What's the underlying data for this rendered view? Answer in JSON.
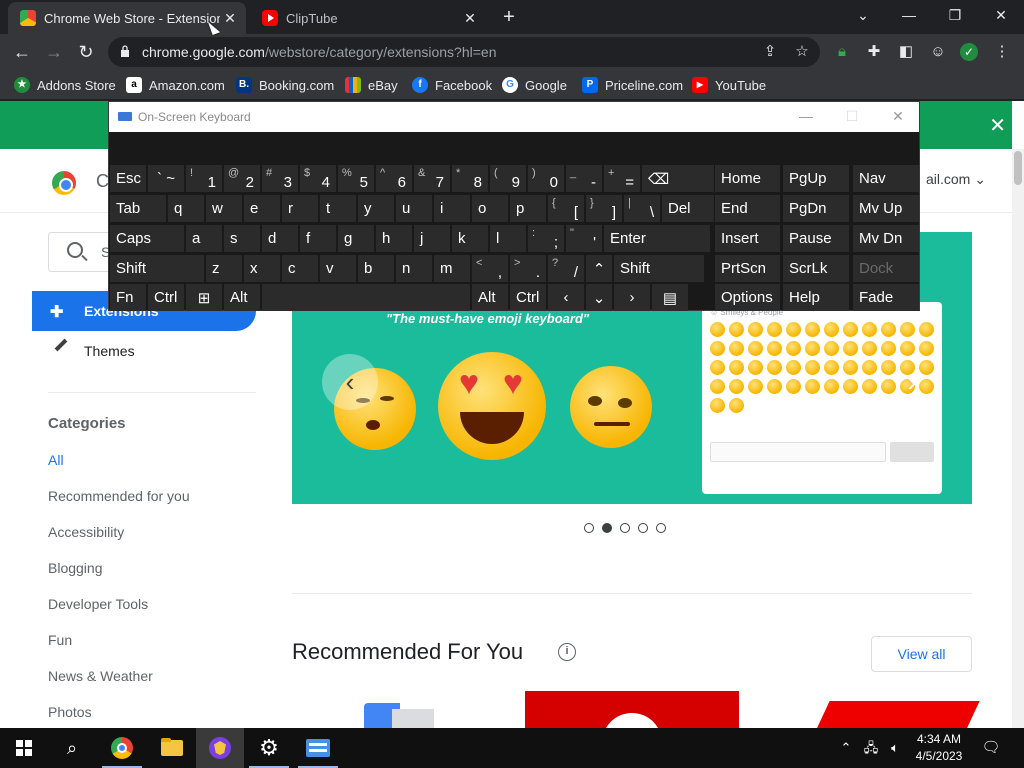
{
  "browser": {
    "tabs": [
      {
        "title": "Chrome Web Store - Extensions",
        "active": true
      },
      {
        "title": "ClipTube",
        "active": false
      }
    ],
    "window_controls": {
      "tab_search": "⌄",
      "minimize": "—",
      "restore": "❐",
      "close": "✕"
    },
    "url": {
      "host": "chrome.google.com",
      "path": "/webstore/category/extensions?hl=en"
    },
    "bookmarks": [
      {
        "label": "Addons Store",
        "icon": "addons-store-icon",
        "color": "#1e8e3e",
        "glyph": "★"
      },
      {
        "label": "Amazon.com",
        "icon": "amazon-icon",
        "color": "#ffffff",
        "glyph": "a"
      },
      {
        "label": "Booking.com",
        "icon": "booking-icon",
        "color": "#003580",
        "glyph": "B."
      },
      {
        "label": "eBay",
        "icon": "ebay-icon",
        "color": "#e53238",
        "glyph": "e"
      },
      {
        "label": "Facebook",
        "icon": "facebook-icon",
        "color": "#1877f2",
        "glyph": "f"
      },
      {
        "label": "Google",
        "icon": "google-icon",
        "color": "#ffffff",
        "glyph": "G"
      },
      {
        "label": "Priceline.com",
        "icon": "priceline-icon",
        "color": "#0068ef",
        "glyph": "P"
      },
      {
        "label": "YouTube",
        "icon": "youtube-icon",
        "color": "#ff0000",
        "glyph": "▶"
      }
    ]
  },
  "store": {
    "header_letter": "C",
    "account_text": "ail.com",
    "search_placeholder": "S",
    "nav": {
      "extensions": "Extensions",
      "themes": "Themes"
    },
    "categories_heading": "Categories",
    "categories": [
      "All",
      "Recommended for you",
      "Accessibility",
      "Blogging",
      "Developer Tools",
      "Fun",
      "News & Weather",
      "Photos"
    ],
    "selected_category": "All",
    "banner_text": "\"The must-have emoji keyboard\"",
    "banner_panel_title": "☺ Smileys & People",
    "carousel_dots": 5,
    "carousel_active_dot": 2,
    "recommended_title": "Recommended For You",
    "view_all": "View all"
  },
  "osk": {
    "title": "On-Screen Keyboard",
    "rows": [
      [
        {
          "m": "Esc",
          "w": 36,
          "name": "key-esc"
        },
        {
          "m": "` ~",
          "w": 36,
          "name": "key-backtick",
          "center": true
        },
        {
          "s": "!",
          "m": "1",
          "w": 36,
          "name": "key-1"
        },
        {
          "s": "@",
          "m": "2",
          "w": 36,
          "name": "key-2"
        },
        {
          "s": "#",
          "m": "3",
          "w": 36,
          "name": "key-3"
        },
        {
          "s": "$",
          "m": "4",
          "w": 36,
          "name": "key-4"
        },
        {
          "s": "%",
          "m": "5",
          "w": 36,
          "name": "key-5"
        },
        {
          "s": "^",
          "m": "6",
          "w": 36,
          "name": "key-6"
        },
        {
          "s": "&",
          "m": "7",
          "w": 36,
          "name": "key-7"
        },
        {
          "s": "*",
          "m": "8",
          "w": 36,
          "name": "key-8"
        },
        {
          "s": "(",
          "m": "9",
          "w": 36,
          "name": "key-9"
        },
        {
          "s": ")",
          "m": "0",
          "w": 36,
          "name": "key-0"
        },
        {
          "s": "_",
          "m": "-",
          "w": 36,
          "name": "key-minus"
        },
        {
          "s": "+",
          "m": "=",
          "w": 36,
          "name": "key-equals"
        },
        {
          "m": "⌫",
          "w": 72,
          "name": "key-backspace",
          "center": false
        }
      ],
      [
        {
          "m": "Tab",
          "w": 56,
          "name": "key-tab"
        },
        {
          "m": "q",
          "w": 36,
          "name": "key-q"
        },
        {
          "m": "w",
          "w": 36,
          "name": "key-w"
        },
        {
          "m": "e",
          "w": 36,
          "name": "key-e"
        },
        {
          "m": "r",
          "w": 36,
          "name": "key-r"
        },
        {
          "m": "t",
          "w": 36,
          "name": "key-t"
        },
        {
          "m": "y",
          "w": 36,
          "name": "key-y"
        },
        {
          "m": "u",
          "w": 36,
          "name": "key-u"
        },
        {
          "m": "i",
          "w": 36,
          "name": "key-i"
        },
        {
          "m": "o",
          "w": 36,
          "name": "key-o"
        },
        {
          "m": "p",
          "w": 36,
          "name": "key-p"
        },
        {
          "s": "{",
          "m": "[",
          "w": 36,
          "name": "key-lbracket"
        },
        {
          "s": "}",
          "m": "]",
          "w": 36,
          "name": "key-rbracket"
        },
        {
          "s": "|",
          "m": "\\",
          "w": 36,
          "name": "key-backslash"
        },
        {
          "m": "Del",
          "w": 52,
          "name": "key-del"
        }
      ],
      [
        {
          "m": "Caps",
          "w": 74,
          "name": "key-caps"
        },
        {
          "m": "a",
          "w": 36,
          "name": "key-a"
        },
        {
          "m": "s",
          "w": 36,
          "name": "key-s"
        },
        {
          "m": "d",
          "w": 36,
          "name": "key-d"
        },
        {
          "m": "f",
          "w": 36,
          "name": "key-f"
        },
        {
          "m": "g",
          "w": 36,
          "name": "key-g"
        },
        {
          "m": "h",
          "w": 36,
          "name": "key-h"
        },
        {
          "m": "j",
          "w": 36,
          "name": "key-j"
        },
        {
          "m": "k",
          "w": 36,
          "name": "key-k"
        },
        {
          "m": "l",
          "w": 36,
          "name": "key-l"
        },
        {
          "s": ":",
          "m": ";",
          "w": 36,
          "name": "key-semicolon"
        },
        {
          "s": "\"",
          "m": "'",
          "w": 36,
          "name": "key-quote"
        },
        {
          "m": "Enter",
          "w": 106,
          "name": "key-enter"
        }
      ],
      [
        {
          "m": "Shift",
          "w": 94,
          "name": "key-shift-left"
        },
        {
          "m": "z",
          "w": 36,
          "name": "key-z"
        },
        {
          "m": "x",
          "w": 36,
          "name": "key-x"
        },
        {
          "m": "c",
          "w": 36,
          "name": "key-c"
        },
        {
          "m": "v",
          "w": 36,
          "name": "key-v"
        },
        {
          "m": "b",
          "w": 36,
          "name": "key-b"
        },
        {
          "m": "n",
          "w": 36,
          "name": "key-n"
        },
        {
          "m": "m",
          "w": 36,
          "name": "key-m"
        },
        {
          "s": "<",
          "m": ",",
          "w": 36,
          "name": "key-comma"
        },
        {
          "s": ">",
          "m": ".",
          "w": 36,
          "name": "key-period"
        },
        {
          "s": "?",
          "m": "/",
          "w": 36,
          "name": "key-slash"
        },
        {
          "m": "⌃",
          "w": 26,
          "name": "key-up-arrow",
          "center": true
        },
        {
          "m": "Shift",
          "w": 90,
          "name": "key-shift-right"
        }
      ],
      [
        {
          "m": "Fn",
          "w": 36,
          "name": "key-fn"
        },
        {
          "m": "Ctrl",
          "w": 36,
          "name": "key-ctrl-left"
        },
        {
          "m": "⊞",
          "w": 36,
          "name": "key-windows",
          "center": true
        },
        {
          "m": "Alt",
          "w": 36,
          "name": "key-alt-left"
        },
        {
          "m": "",
          "w": 208,
          "name": "key-space"
        },
        {
          "m": "Alt",
          "w": 36,
          "name": "key-alt-right"
        },
        {
          "m": "Ctrl",
          "w": 36,
          "name": "key-ctrl-right"
        },
        {
          "m": "‹",
          "w": 36,
          "name": "key-left-arrow",
          "center": true
        },
        {
          "m": "⌄",
          "w": 26,
          "name": "key-down-arrow",
          "center": true
        },
        {
          "m": "›",
          "w": 36,
          "name": "key-right-arrow",
          "center": true
        },
        {
          "m": "▤",
          "w": 36,
          "name": "key-menu",
          "center": true
        }
      ]
    ],
    "side_keys": [
      [
        {
          "m": "Home",
          "name": "key-home"
        },
        {
          "m": "PgUp",
          "name": "key-pgup"
        },
        {
          "m": "Nav",
          "name": "key-nav"
        }
      ],
      [
        {
          "m": "End",
          "name": "key-end"
        },
        {
          "m": "PgDn",
          "name": "key-pgdn"
        },
        {
          "m": "Mv Up",
          "name": "key-mv-up"
        }
      ],
      [
        {
          "m": "Insert",
          "name": "key-insert"
        },
        {
          "m": "Pause",
          "name": "key-pause"
        },
        {
          "m": "Mv Dn",
          "name": "key-mv-dn"
        }
      ],
      [
        {
          "m": "PrtScn",
          "name": "key-prtscn"
        },
        {
          "m": "ScrLk",
          "name": "key-scrlk"
        },
        {
          "m": "Dock",
          "name": "key-dock",
          "dim": true
        }
      ],
      [
        {
          "m": "Options",
          "name": "key-options"
        },
        {
          "m": "Help",
          "name": "key-help"
        },
        {
          "m": "Fade",
          "name": "key-fade"
        }
      ]
    ]
  },
  "taskbar": {
    "time": "4:34 AM",
    "date": "4/5/2023"
  }
}
